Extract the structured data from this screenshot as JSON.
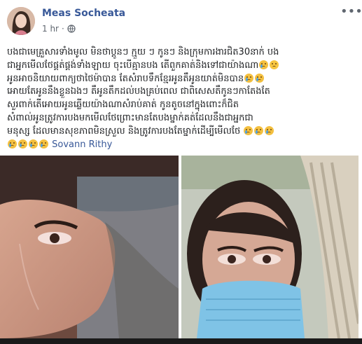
{
  "post": {
    "author": "Meas Socheata",
    "time": "1 hr",
    "audience_icon": "globe-icon",
    "more_icon": "more-icon",
    "lines": [
      "បងជាមេគ្រួសារទាំងមូល មិនថាប្ដូនៗ ក្មួយ ៗ កូនៗ និងក្រុមការងារជិត30នាក់ បង",
      "ជាអ្នកមើលថែផ្គត់ផ្គង់ទាំងឡាយ ចុះបើគ្មានបង តើពួកគាត់និងទៅជាយ៉ាងណា",
      "អូនអាចនិយាយពាក្យថាថៃម៉ាបាន តែសំរាបទឹកខ្មែរអូនតឹអូនយាត់មិនបាន",
      "អោយតែអូននឹងខ្លួនឯងៗ តឹអូនតឹកដល់បងគ្រប់ពេល ជាពិសេសតឹកូនៗកាតែងតែ",
      "សួរពាក់តើអោយអូនឆ្លើយយ៉ាងណាសំរាប់គាត់ កូនតូចនៅក្នុងពោះក៏ជិត",
      "សំពាល់អូនត្រូវការបងមកមើលថែព្រោះមានតែបងម្នាក់គត់ដែលនឹងជាអ្នកជា",
      "មនុស្ស ដែលមានសុខភាពមិនស្រួល និងត្រូវការបងតែម្នាក់ដើម្បីមើលថែ"
    ],
    "emoji_sad": "sad-emoji",
    "emoji_cry": "crying-emoji",
    "tagged_person": "Sovann Rithy"
  },
  "photos": [
    {
      "label": "photo-left",
      "icon": "photo"
    },
    {
      "label": "photo-right",
      "icon": "photo"
    }
  ],
  "colors": {
    "link": "#385898",
    "meta": "#606770",
    "text": "#1c1e21"
  }
}
